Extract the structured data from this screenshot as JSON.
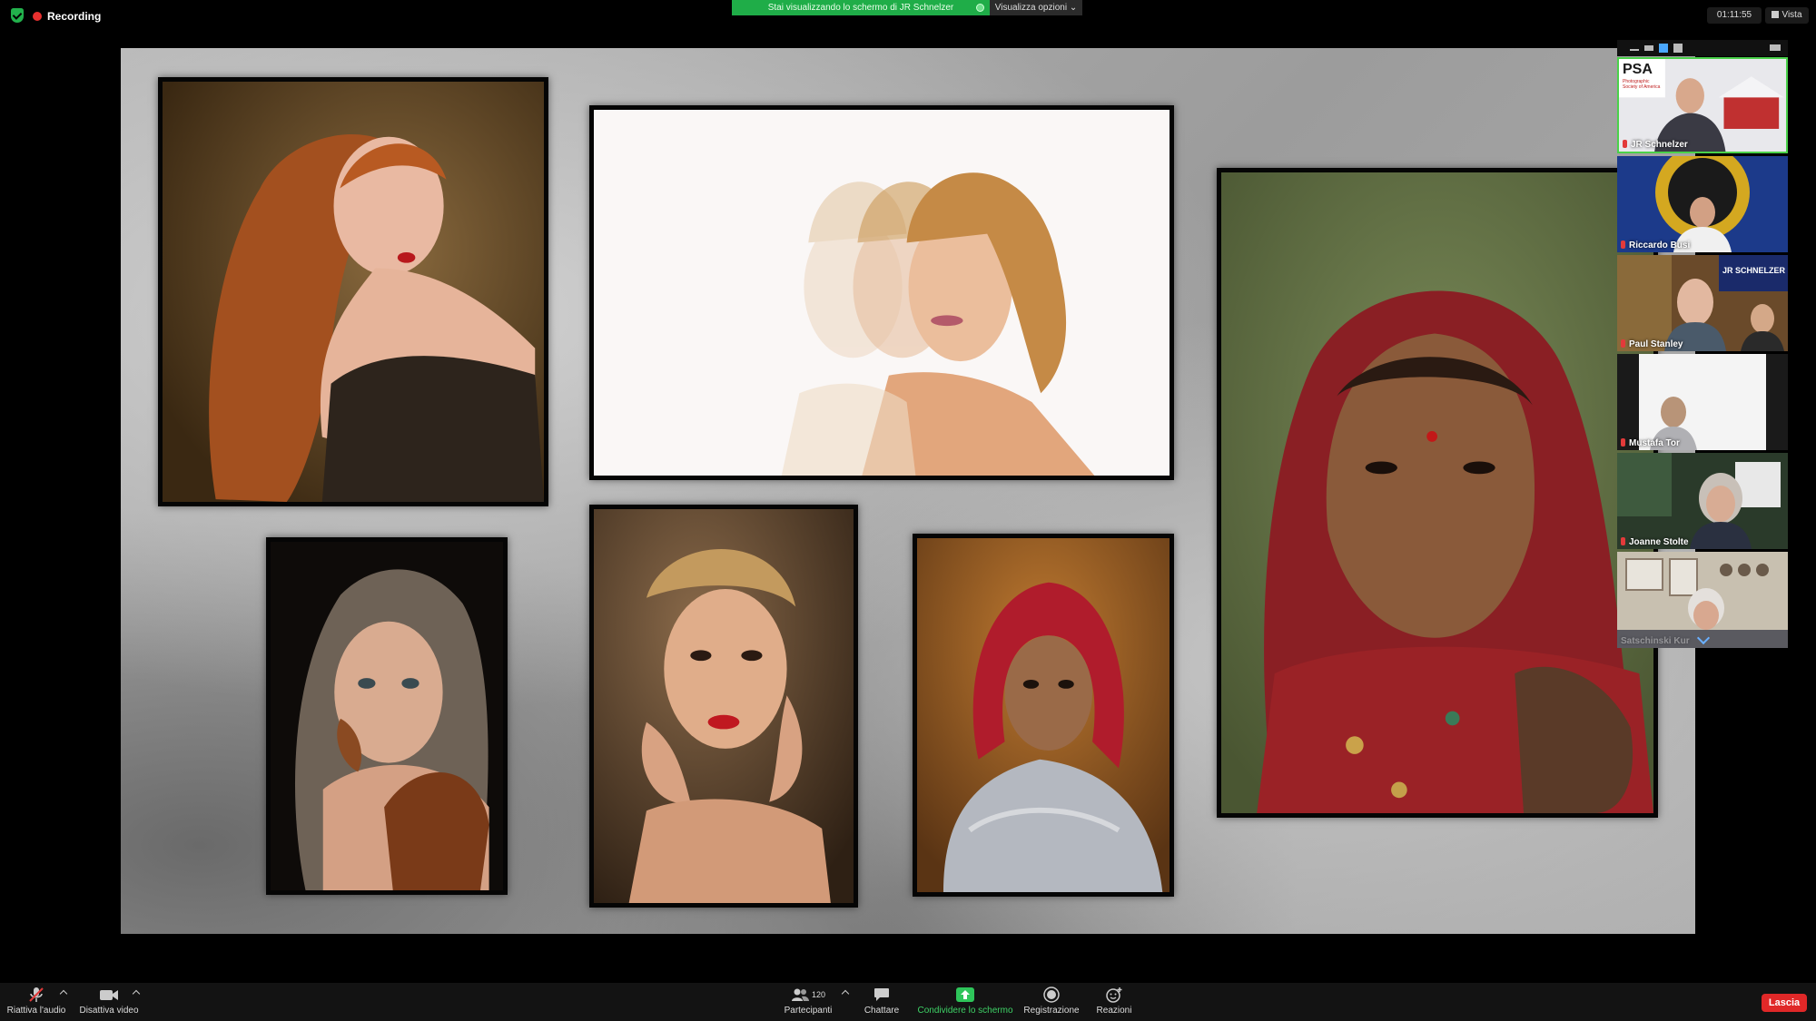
{
  "top_bar": {
    "recording_label": "Recording",
    "share_message": "Stai visualizzando lo schermo di JR Schnelzer",
    "view_options_label": "Visualizza opzioni",
    "elapsed_time": "01:11:55",
    "view_label": "Vista"
  },
  "participants": [
    {
      "name": "JR Schnelzer",
      "badge": "PSA",
      "badge_sub": "Photographic Society of America"
    },
    {
      "name": "Riccardo Busi"
    },
    {
      "name": "Paul Stanley",
      "banner_title": "JR SCHNELZER"
    },
    {
      "name": "Mustafa Tor"
    },
    {
      "name": "Joanne Stolte"
    },
    {
      "name": "Satschinski Kur"
    }
  ],
  "bottom_bar": {
    "audio_label": "Riattiva l'audio",
    "video_label": "Disattiva video",
    "participants_label": "Partecipanti",
    "participants_count": "120",
    "chat_label": "Chattare",
    "share_label": "Condividere lo schermo",
    "record_label": "Registrazione",
    "reactions_label": "Reazioni",
    "leave_label": "Lascia"
  },
  "colors": {
    "share_green": "#1fad48",
    "leave_red": "#e02828",
    "recording_red": "#e8302f"
  }
}
